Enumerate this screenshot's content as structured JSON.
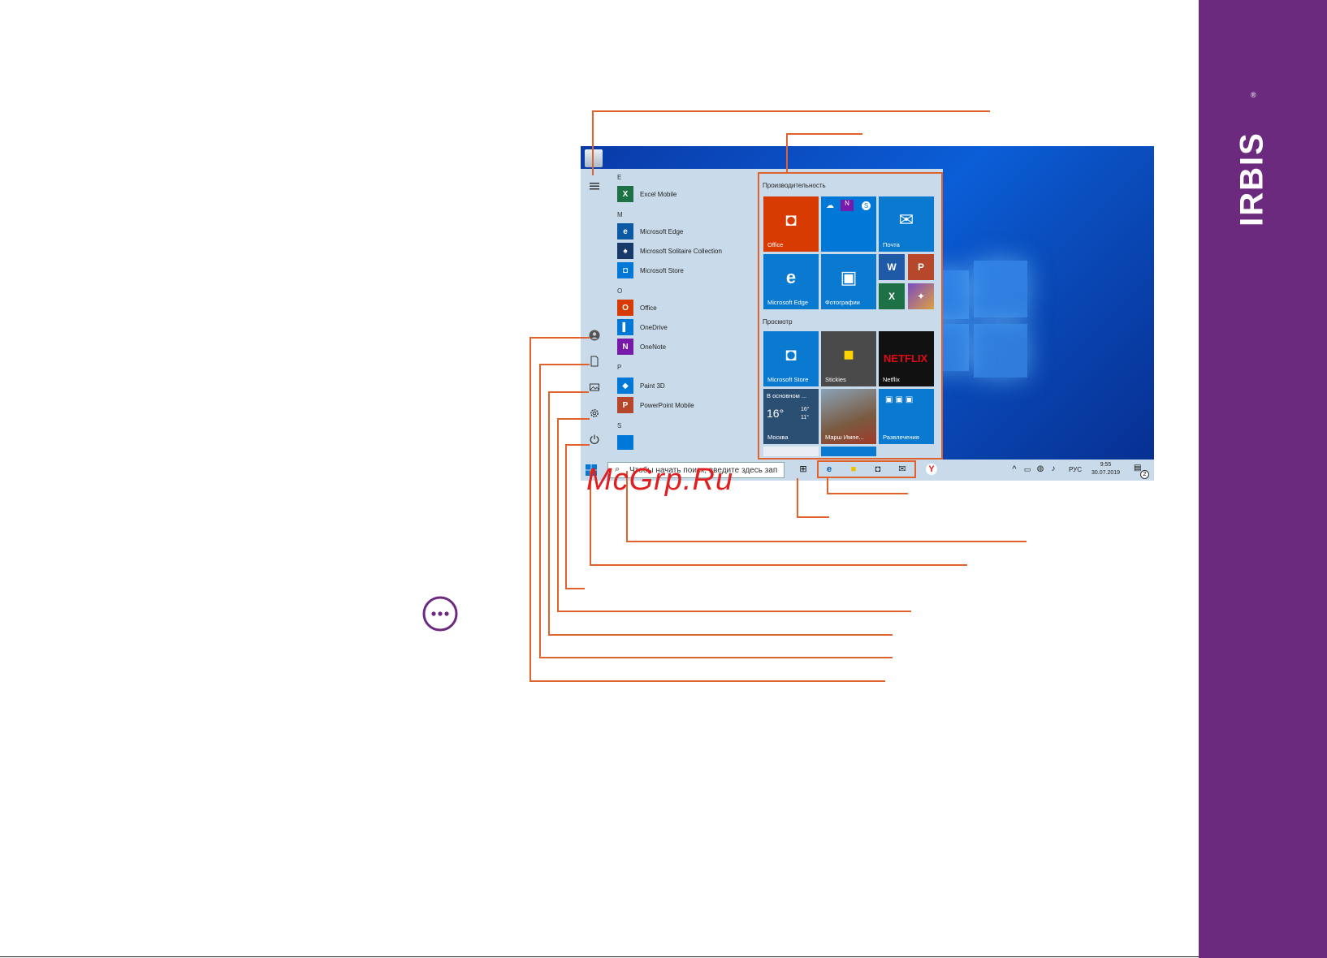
{
  "brand": {
    "name": "IRBIS",
    "reg_mark": "®",
    "band_color": "#6c2a7f"
  },
  "watermark": "McGrp.Ru",
  "accent_color": "#e0622d",
  "start_menu": {
    "app_list": [
      {
        "letter": "E"
      },
      {
        "name": "Excel Mobile",
        "icon": "excel-icon",
        "color": "#1e7145",
        "glyph": "X"
      },
      {
        "letter": "M"
      },
      {
        "name": "Microsoft Edge",
        "icon": "edge-icon",
        "color": "#0c59a4",
        "glyph": "e"
      },
      {
        "name": "Microsoft Solitaire Collection",
        "icon": "solitaire-icon",
        "color": "#173a6b",
        "glyph": "♠"
      },
      {
        "name": "Microsoft Store",
        "icon": "store-icon",
        "color": "#0078d7",
        "glyph": "◘"
      },
      {
        "letter": "O"
      },
      {
        "name": "Office",
        "icon": "office-icon",
        "color": "#d83b01",
        "glyph": "O"
      },
      {
        "name": "OneDrive",
        "icon": "onedrive-icon",
        "color": "#0078d7",
        "glyph": "▌"
      },
      {
        "name": "OneNote",
        "icon": "onenote-icon",
        "color": "#7719aa",
        "glyph": "N"
      },
      {
        "letter": "P"
      },
      {
        "name": "Paint 3D",
        "icon": "paint3d-icon",
        "color": "#0078d7",
        "glyph": "◆"
      },
      {
        "name": "PowerPoint Mobile",
        "icon": "powerpoint-icon",
        "color": "#b7472a",
        "glyph": "P"
      },
      {
        "letter": "S"
      }
    ],
    "groups": {
      "productivity": "Производительность",
      "explore": "Просмотр"
    },
    "tiles": {
      "office": "Office",
      "mail": "Почта",
      "edge": "Microsoft Edge",
      "photos": "Фотографии",
      "store": "Microsoft Store",
      "stickies": "Stickies",
      "netflix": "Netflix",
      "netflix_logo": "NETFLIX",
      "weather_title": "В основном ...",
      "weather_temp": "16°",
      "weather_hi": "16°",
      "weather_lo": "11°",
      "weather_city": "Москва",
      "game": "Марш Импе...",
      "entertainment": "Развлечения"
    }
  },
  "taskbar": {
    "search_placeholder": "Чтобы начать поиск, введите здесь зап",
    "language": "РУС",
    "time": "9:55",
    "date": "30.07.2019",
    "notifications": "2"
  }
}
